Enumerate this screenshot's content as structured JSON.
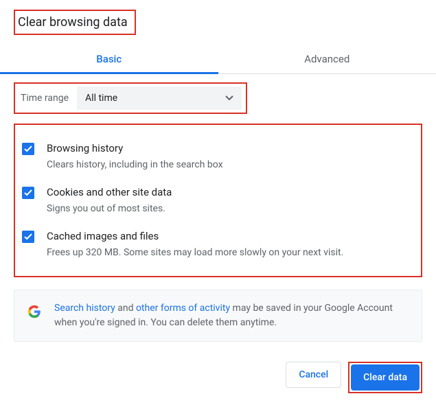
{
  "title": "Clear browsing data",
  "tabs": {
    "basic": "Basic",
    "advanced": "Advanced",
    "active": "basic"
  },
  "timerange": {
    "label": "Time range",
    "value": "All time"
  },
  "options": [
    {
      "title": "Browsing history",
      "desc": "Clears history, including in the search box",
      "checked": true
    },
    {
      "title": "Cookies and other site data",
      "desc": "Signs you out of most sites.",
      "checked": true
    },
    {
      "title": "Cached images and files",
      "desc": "Frees up 320 MB. Some sites may load more slowly on your next visit.",
      "checked": true
    }
  ],
  "info": {
    "link1": "Search history",
    "mid1": " and ",
    "link2": "other forms of activity",
    "rest": " may be saved in your Google Account when you're signed in. You can delete them anytime."
  },
  "buttons": {
    "cancel": "Cancel",
    "clear": "Clear data"
  }
}
